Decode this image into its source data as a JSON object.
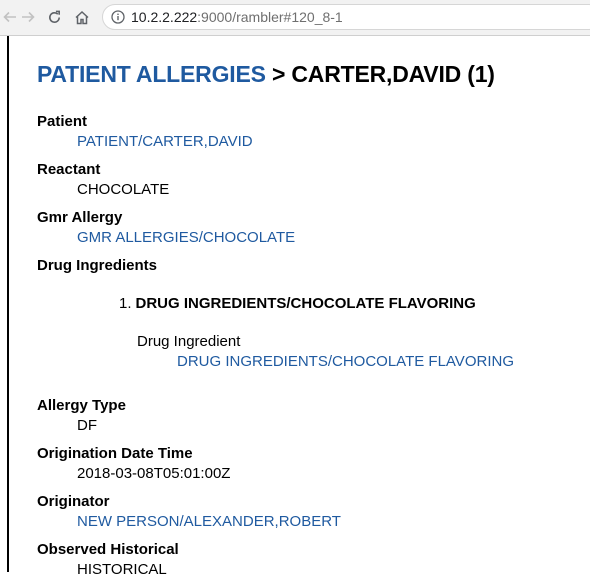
{
  "browser": {
    "url_host": "10.2.2.222",
    "url_rest": ":9000/rambler#120_8-1"
  },
  "title": {
    "crumb": "PATIENT ALLERGIES",
    "separator": ">",
    "record": "CARTER,DAVID (1)"
  },
  "fields": {
    "patient": {
      "label": "Patient",
      "value": "PATIENT/CARTER,DAVID"
    },
    "reactant": {
      "label": "Reactant",
      "value": "CHOCOLATE"
    },
    "gmr_allergy": {
      "label": "Gmr Allergy",
      "value": "GMR ALLERGIES/CHOCOLATE"
    },
    "drug_ingredients": {
      "label": "Drug Ingredients",
      "items": [
        {
          "number": "1.",
          "heading": "DRUG INGREDIENTS/CHOCOLATE FLAVORING",
          "sub_label": "Drug Ingredient",
          "sub_value": "DRUG INGREDIENTS/CHOCOLATE FLAVORING"
        }
      ]
    },
    "allergy_type": {
      "label": "Allergy Type",
      "value": "DF"
    },
    "origination_date_time": {
      "label": "Origination Date Time",
      "value": "2018-03-08T05:01:00Z"
    },
    "originator": {
      "label": "Originator",
      "value": "NEW PERSON/ALEXANDER,ROBERT"
    },
    "observed_historical": {
      "label": "Observed Historical",
      "value": "HISTORICAL"
    }
  }
}
